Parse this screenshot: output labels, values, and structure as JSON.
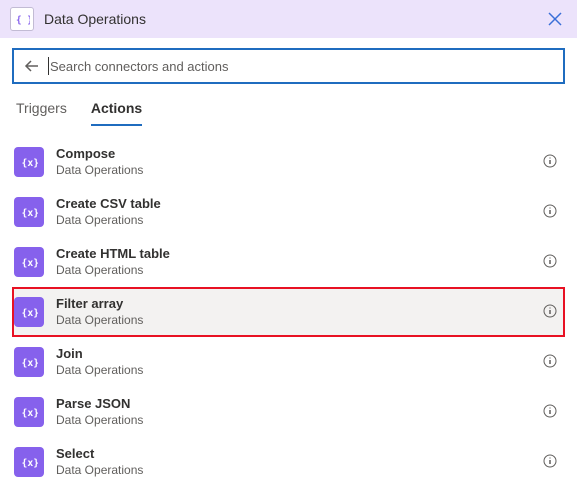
{
  "header": {
    "title": "Data Operations"
  },
  "search": {
    "placeholder": "Search connectors and actions",
    "value": ""
  },
  "tabs": {
    "triggers": "Triggers",
    "actions": "Actions",
    "active": "actions"
  },
  "actions": [
    {
      "title": "Compose",
      "subtitle": "Data Operations",
      "highlighted": false
    },
    {
      "title": "Create CSV table",
      "subtitle": "Data Operations",
      "highlighted": false
    },
    {
      "title": "Create HTML table",
      "subtitle": "Data Operations",
      "highlighted": false
    },
    {
      "title": "Filter array",
      "subtitle": "Data Operations",
      "highlighted": true
    },
    {
      "title": "Join",
      "subtitle": "Data Operations",
      "highlighted": false
    },
    {
      "title": "Parse JSON",
      "subtitle": "Data Operations",
      "highlighted": false
    },
    {
      "title": "Select",
      "subtitle": "Data Operations",
      "highlighted": false
    }
  ]
}
